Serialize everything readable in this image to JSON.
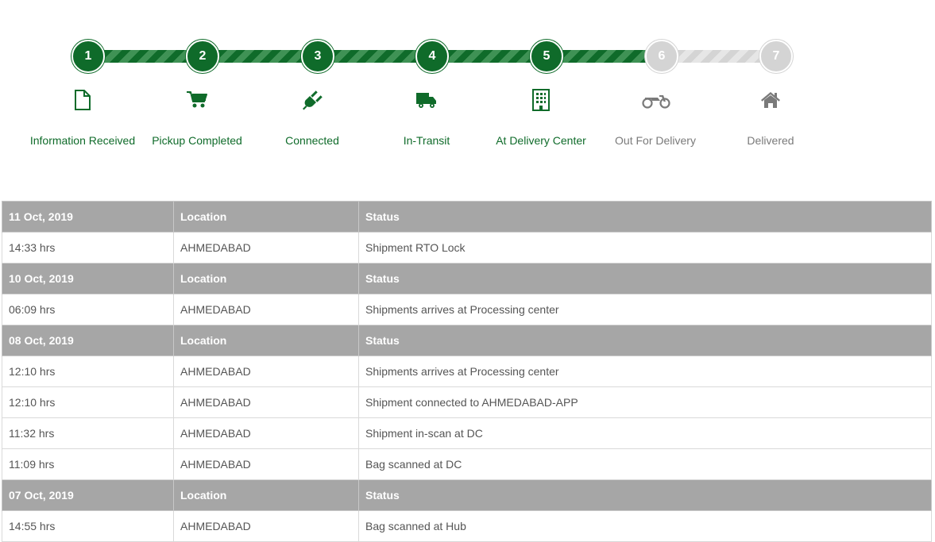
{
  "tracker": {
    "steps": [
      {
        "number": "1",
        "label": "Information Received",
        "icon": "document-icon",
        "state": "done"
      },
      {
        "number": "2",
        "label": "Pickup Completed",
        "icon": "cart-icon",
        "state": "done"
      },
      {
        "number": "3",
        "label": "Connected",
        "icon": "plug-icon",
        "state": "done"
      },
      {
        "number": "4",
        "label": "In-Transit",
        "icon": "truck-icon",
        "state": "done"
      },
      {
        "number": "5",
        "label": "At Delivery Center",
        "icon": "building-icon",
        "state": "done"
      },
      {
        "number": "6",
        "label": "Out For Delivery",
        "icon": "motorcycle-icon",
        "state": "todo"
      },
      {
        "number": "7",
        "label": "Delivered",
        "icon": "home-icon",
        "state": "todo"
      }
    ],
    "colors": {
      "done": "#0f6b2a",
      "todo": "#d4d4d4",
      "done_label": "#0f6b2a",
      "todo_label": "#7a7a7a"
    }
  },
  "history": {
    "location_header": "Location",
    "status_header": "Status",
    "groups": [
      {
        "date": "11 Oct, 2019",
        "events": [
          {
            "time": "14:33 hrs",
            "location": "AHMEDABAD",
            "status": "Shipment RTO Lock"
          }
        ]
      },
      {
        "date": "10 Oct, 2019",
        "events": [
          {
            "time": "06:09 hrs",
            "location": "AHMEDABAD",
            "status": "Shipments arrives at Processing center"
          }
        ]
      },
      {
        "date": "08 Oct, 2019",
        "events": [
          {
            "time": "12:10 hrs",
            "location": "AHMEDABAD",
            "status": "Shipments arrives at Processing center"
          },
          {
            "time": "12:10 hrs",
            "location": "AHMEDABAD",
            "status": "Shipment connected to AHMEDABAD-APP"
          },
          {
            "time": "11:32 hrs",
            "location": "AHMEDABAD",
            "status": "Shipment in-scan at DC"
          },
          {
            "time": "11:09 hrs",
            "location": "AHMEDABAD",
            "status": "Bag scanned at DC"
          }
        ]
      },
      {
        "date": "07 Oct, 2019",
        "events": [
          {
            "time": "14:55 hrs",
            "location": "AHMEDABAD",
            "status": "Bag scanned at Hub"
          }
        ]
      }
    ]
  }
}
